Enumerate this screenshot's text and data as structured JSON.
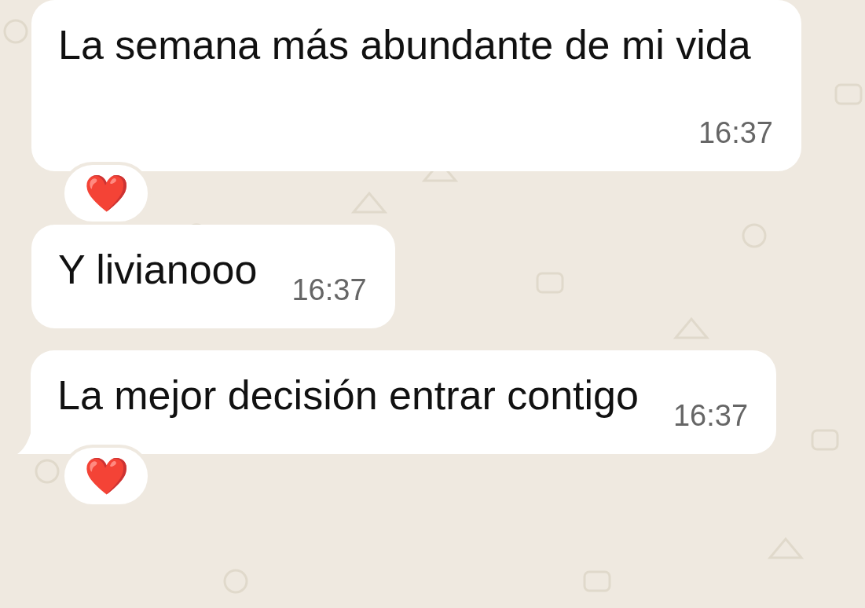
{
  "messages": [
    {
      "text": "La semana más abundante de mi vida",
      "time": "16:37",
      "tail": false,
      "reaction": "❤️"
    },
    {
      "text": "Y livianooo",
      "time": "16:37",
      "tail": false
    },
    {
      "text": "La mejor decisión entrar contigo",
      "time": "16:37",
      "tail": true,
      "reaction": "❤️"
    }
  ]
}
